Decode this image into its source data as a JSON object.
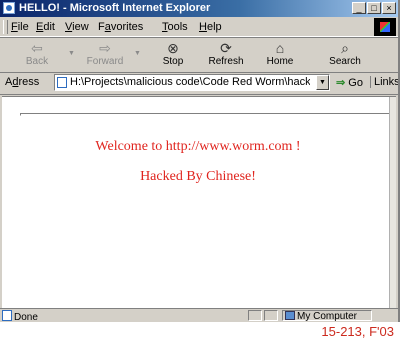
{
  "window": {
    "title": "HELLO! - Microsoft Internet Explorer",
    "minimize": "_",
    "maximize": "□",
    "close": "×"
  },
  "menu": {
    "items": [
      {
        "ul": "F",
        "rest": "ile"
      },
      {
        "ul": "E",
        "rest": "dit"
      },
      {
        "ul": "V",
        "rest": "iew"
      },
      {
        "pre": "F",
        "ul": "a",
        "rest": "vorites"
      },
      {
        "ul": "T",
        "rest": "ools"
      },
      {
        "ul": "H",
        "rest": "elp"
      }
    ]
  },
  "toolbar": {
    "back": {
      "label": "Back",
      "icon": "⇦"
    },
    "forward": {
      "label": "Forward",
      "icon": "⇨"
    },
    "stop": {
      "label": "Stop",
      "icon": "⊗"
    },
    "refresh": {
      "label": "Refresh",
      "icon": "⟳"
    },
    "home": {
      "label": "Home",
      "icon": "⌂"
    },
    "search": {
      "label": "Search",
      "icon": "⌕"
    }
  },
  "address": {
    "label_ul": "d",
    "label_pre": "A",
    "label_rest": "ress",
    "value": "H:\\Projects\\malicious code\\Code Red Worm\\hackedwe",
    "go": "Go",
    "links": "Links"
  },
  "page": {
    "line1": "Welcome to http://www.worm.com !",
    "line2": "Hacked By Chinese!"
  },
  "status": {
    "text": "Done",
    "zone": "My Computer"
  },
  "caption": "15-213, F'03",
  "colors": {
    "title_bg": "#0a246a",
    "message": "#e0241e",
    "chrome": "#d4d0c8"
  }
}
